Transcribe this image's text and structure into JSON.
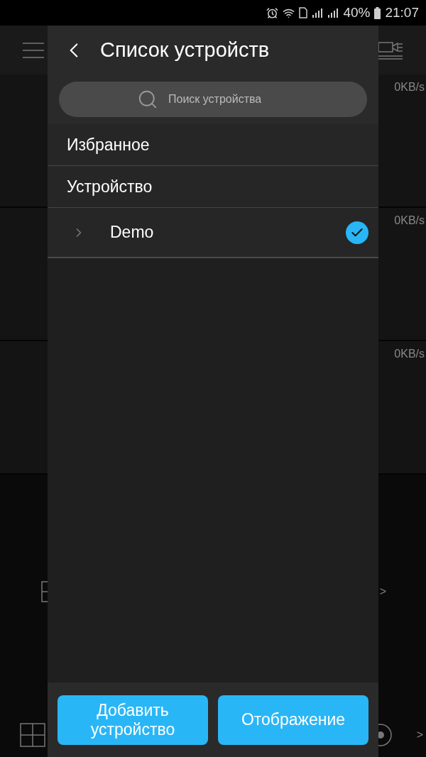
{
  "status_bar": {
    "battery": "40%",
    "time": "21:07"
  },
  "background": {
    "speeds": [
      "0KB/s",
      "0KB/s",
      "0KB/s"
    ],
    "arrows": [
      ">",
      ">"
    ]
  },
  "drawer": {
    "title": "Список устройств",
    "search": {
      "placeholder": "Поиск устройства"
    },
    "sections": [
      {
        "label": "Избранное"
      },
      {
        "label": "Устройство"
      }
    ],
    "devices": [
      {
        "name": "Demo",
        "checked": true,
        "expanded": false
      }
    ],
    "buttons": [
      "Добавить устройство",
      "Отображение"
    ]
  }
}
